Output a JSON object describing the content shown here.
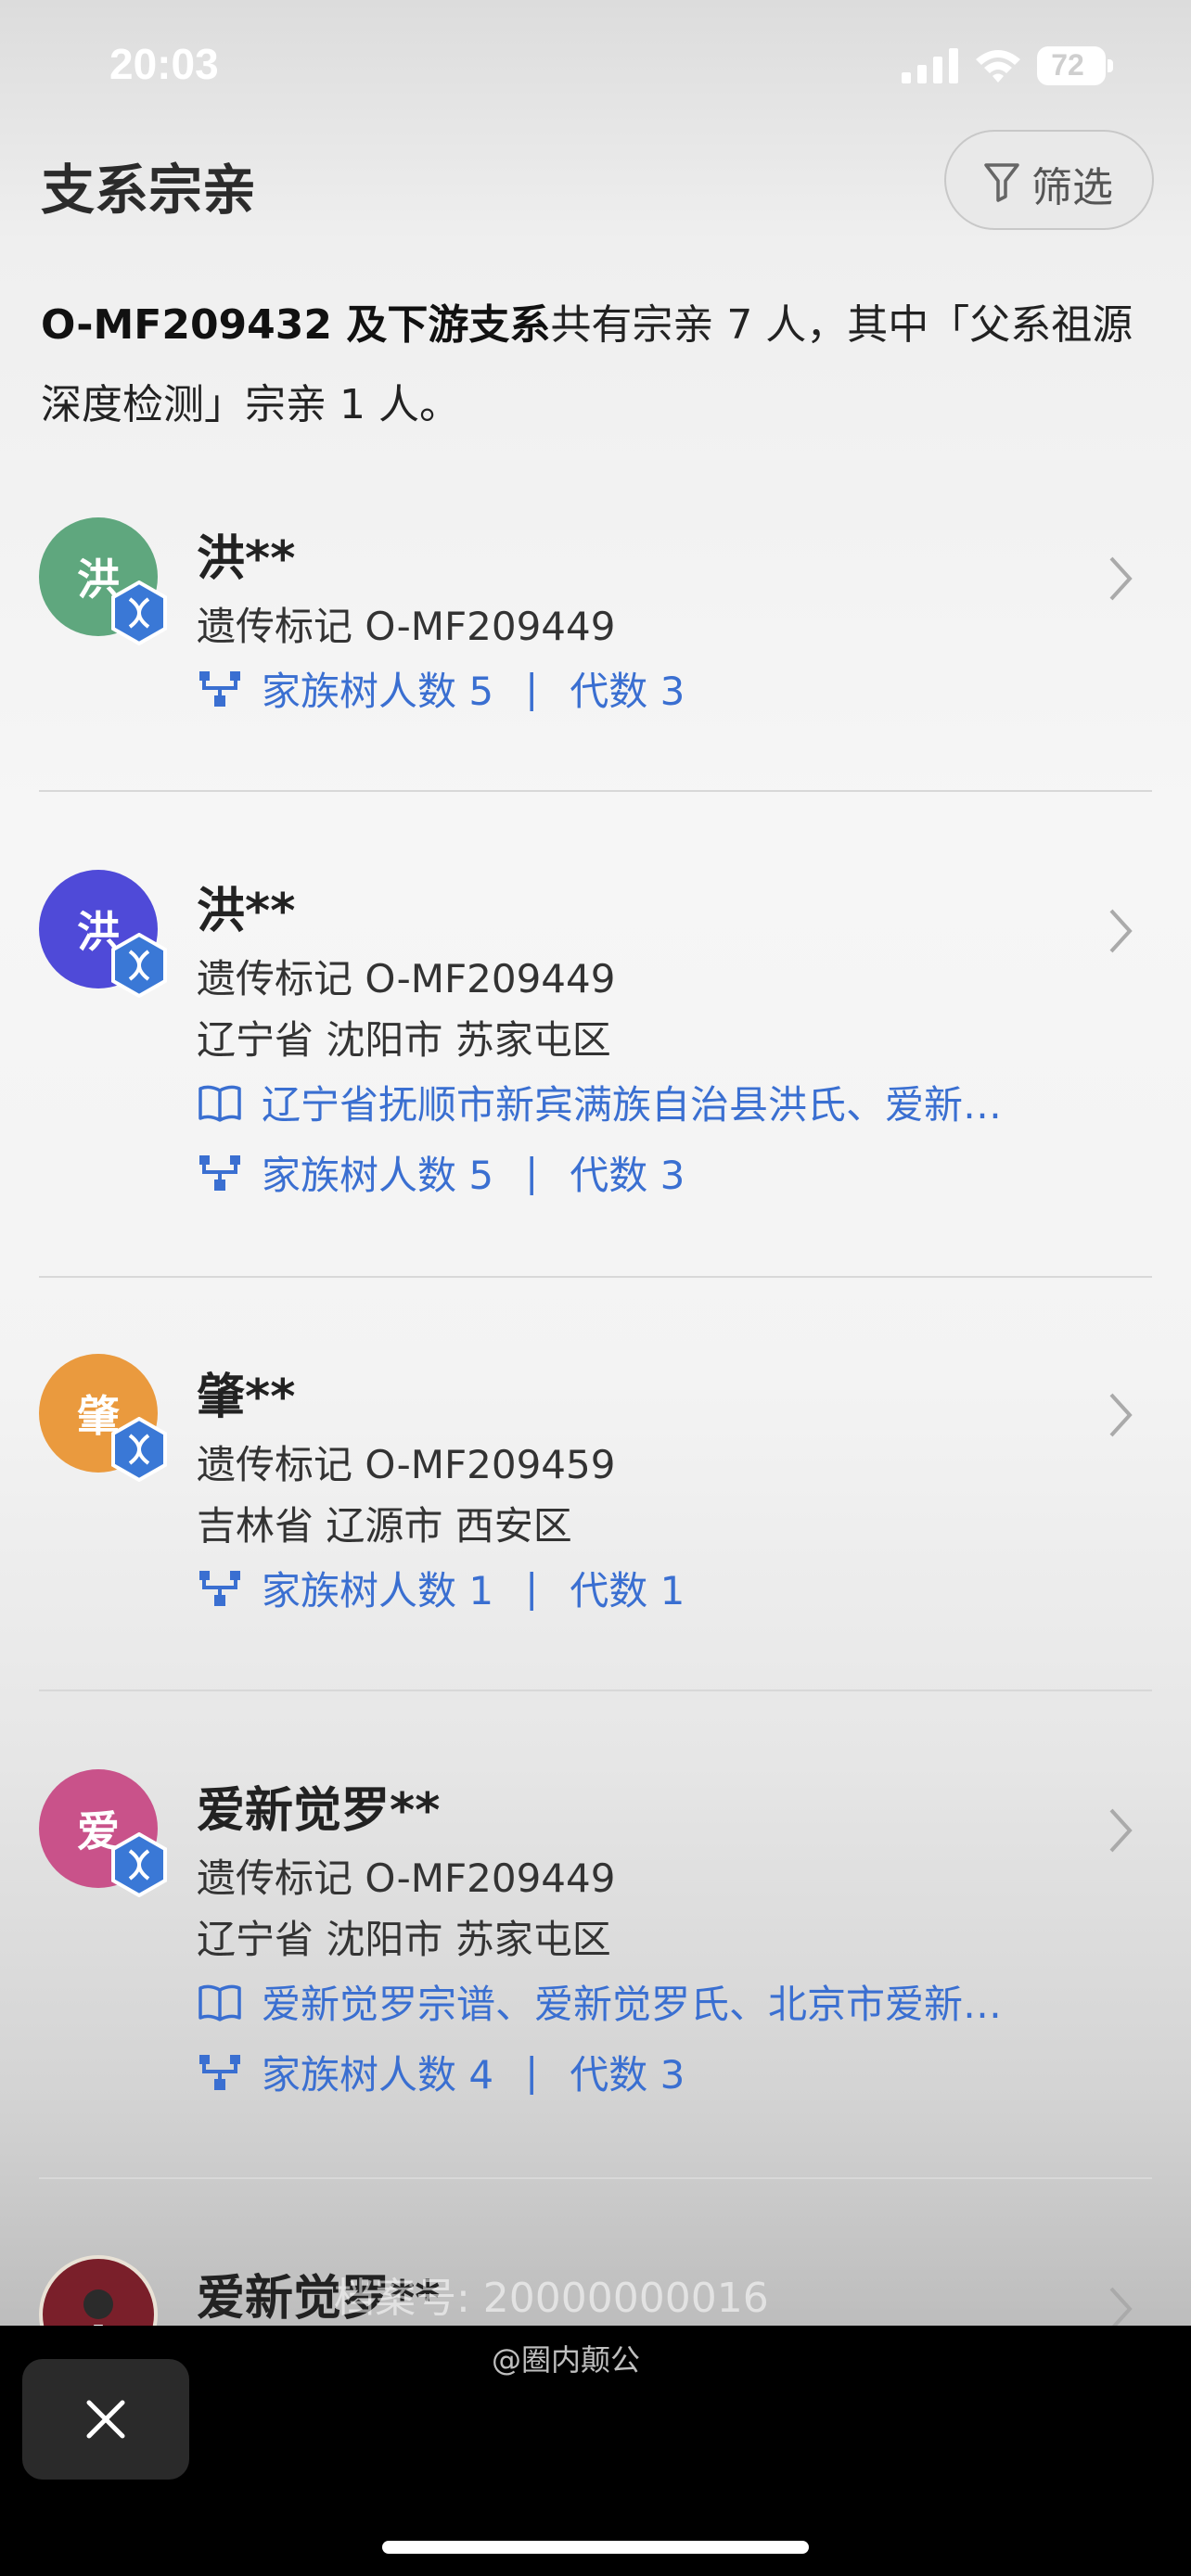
{
  "status_bar": {
    "time": "20:03",
    "battery": "72"
  },
  "header": {
    "title": "支系宗亲",
    "filter_label": "筛选"
  },
  "summary": {
    "bold": "O-MF209432 及下游支系",
    "rest": "共有宗亲 7 人，其中「父系祖源深度检测」宗亲 1 人。"
  },
  "cards": [
    {
      "avatar_char": "洪",
      "name": "洪**",
      "marker": "遗传标记 O-MF209449",
      "tree_count": "家族树人数 5",
      "sep": "|",
      "generation": "代数 3"
    },
    {
      "avatar_char": "洪",
      "name": "洪**",
      "marker": "遗传标记 O-MF209449",
      "location": "辽宁省 沈阳市 苏家屯区",
      "genealogy": "辽宁省抚顺市新宾满族自治县洪氏、爱新…",
      "tree_count": "家族树人数 5",
      "sep": "|",
      "generation": "代数 3"
    },
    {
      "avatar_char": "肇",
      "name": "肇**",
      "marker": "遗传标记 O-MF209459",
      "location": "吉林省 辽源市 西安区",
      "tree_count": "家族树人数 1",
      "sep": "|",
      "generation": "代数 1"
    },
    {
      "avatar_char": "爱",
      "name": "爱新觉罗**",
      "marker": "遗传标记 O-MF209449",
      "location": "辽宁省 沈阳市 苏家屯区",
      "genealogy": "爱新觉罗宗谱、爱新觉罗氏、北京市爱新…",
      "tree_count": "家族树人数 4",
      "sep": "|",
      "generation": "代数 3"
    },
    {
      "name": "爱新觉罗**"
    }
  ],
  "watermark": "档案号: 20000000016",
  "credit": "@圈内颠公",
  "colors": {
    "avatar_1": "#5fa77e",
    "avatar_2": "#4f4ad8",
    "avatar_3": "#ea9a3e",
    "avatar_4": "#c9528a",
    "link": "#3a6fd1",
    "badge": "#3a78d6"
  },
  "icons": [
    "signal-icon",
    "wifi-icon",
    "battery-icon",
    "filter-icon",
    "dna-badge-icon",
    "family-tree-icon",
    "book-icon",
    "chevron-right-icon",
    "close-icon"
  ]
}
